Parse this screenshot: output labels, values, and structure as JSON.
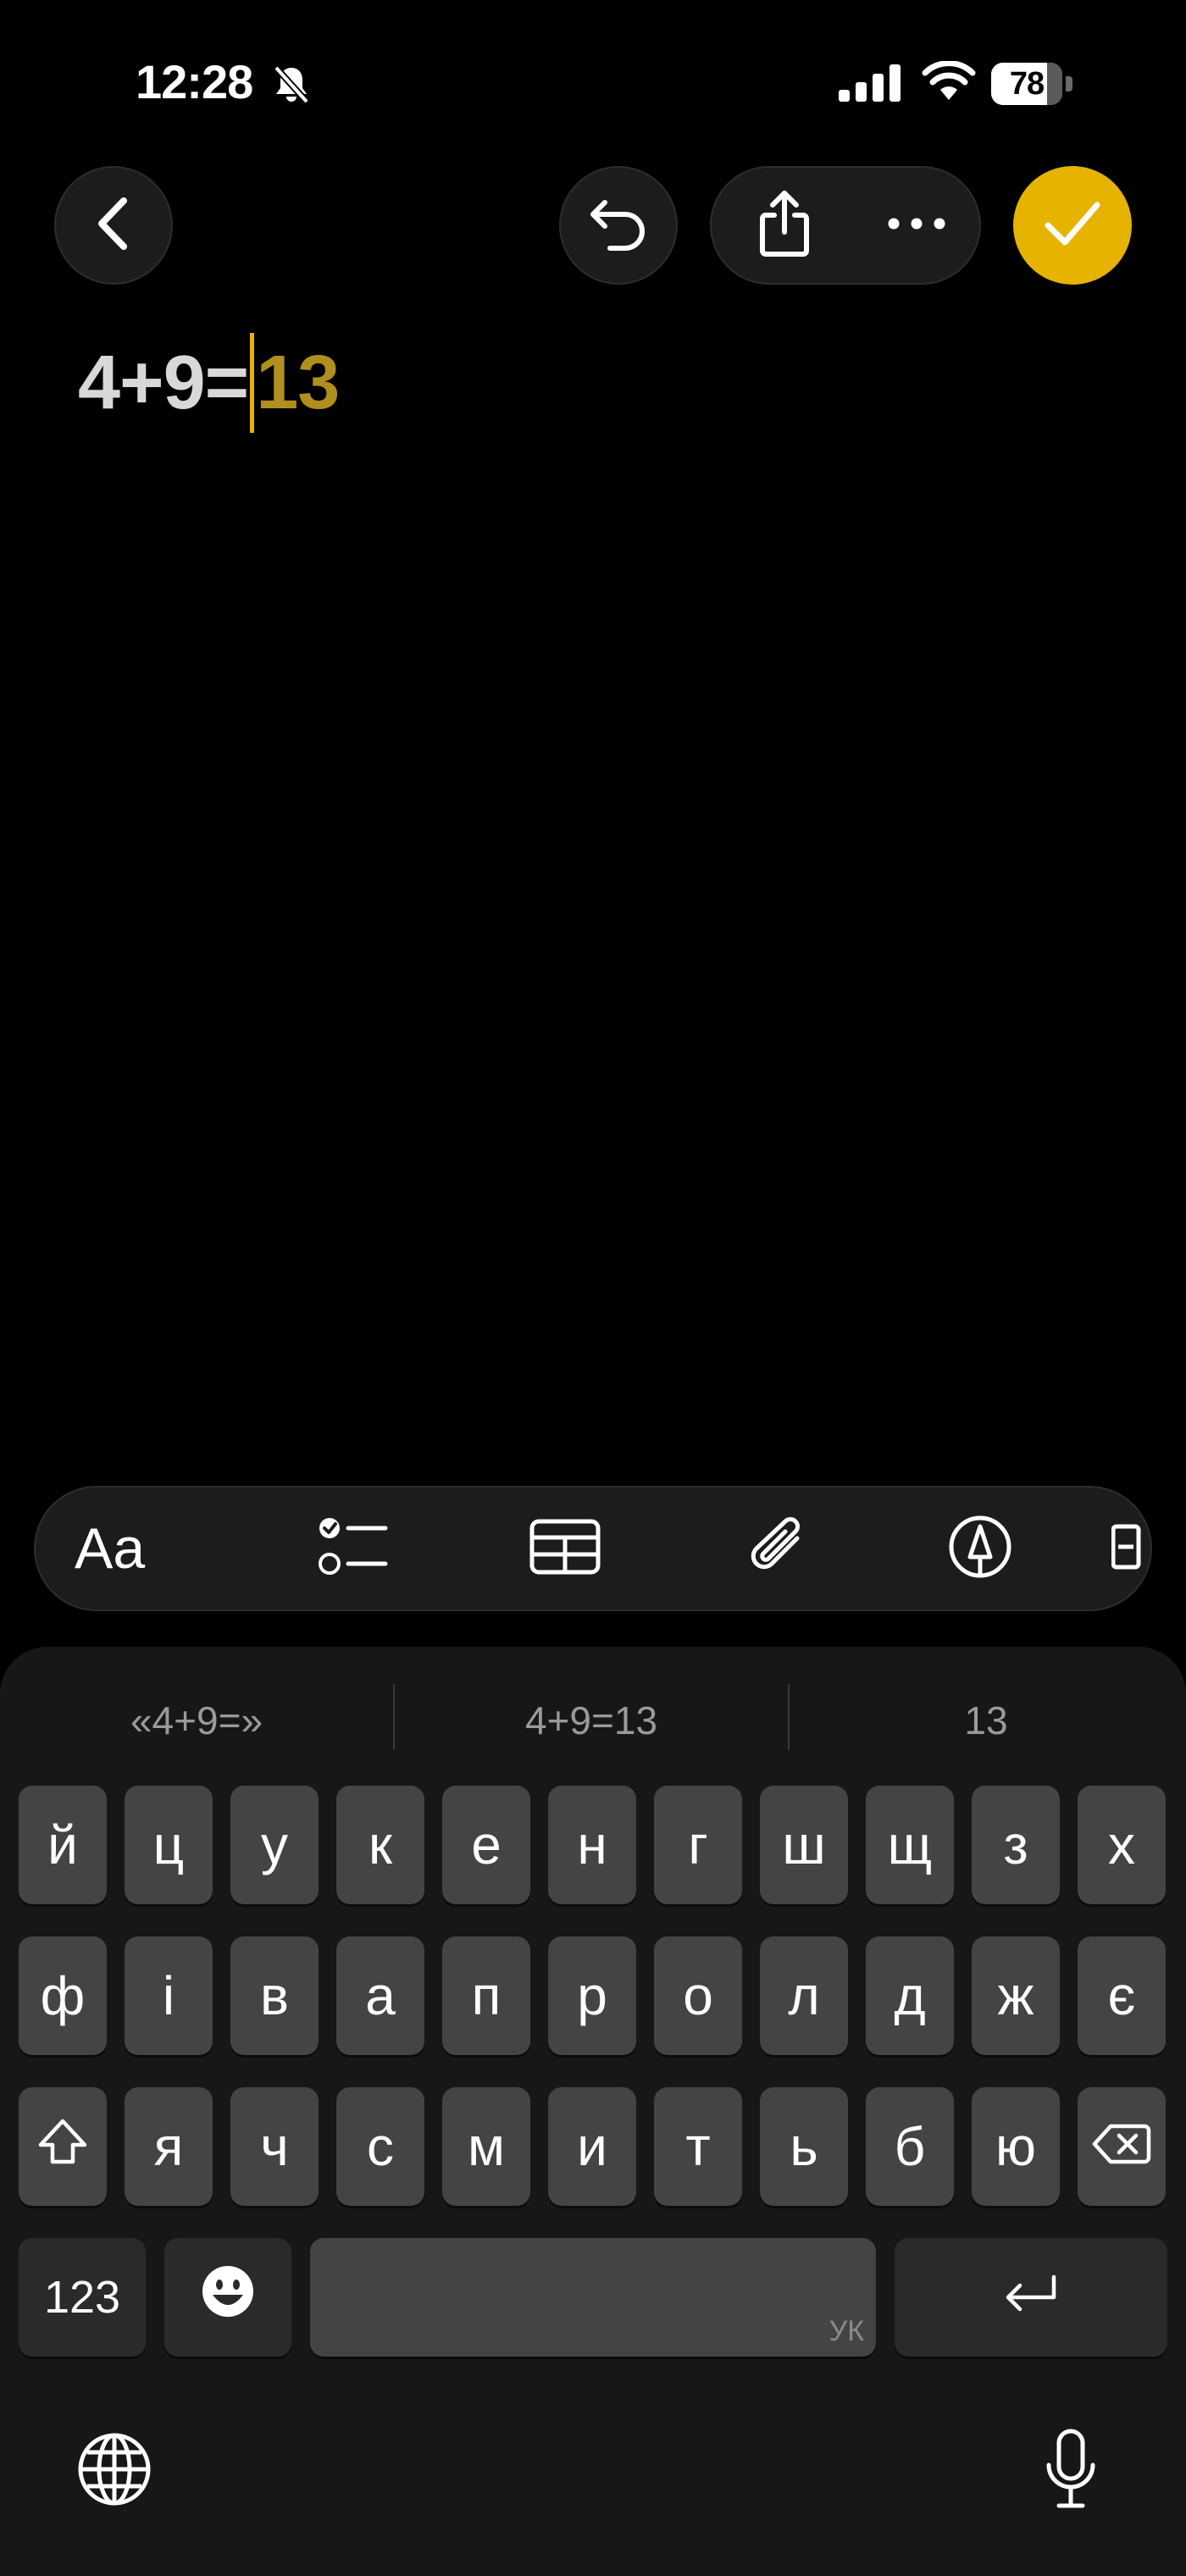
{
  "status": {
    "time": "12:28",
    "battery_level": "78",
    "battery_percent": 78,
    "icons": [
      "bell-slash-icon",
      "cellular-signal-icon",
      "wifi-icon",
      "battery-icon"
    ]
  },
  "toolbar": {
    "icons": [
      "chevron-left-icon",
      "undo-icon",
      "share-icon",
      "ellipsis-icon",
      "checkmark-icon"
    ],
    "accent_color": "#e5b300"
  },
  "note": {
    "expression": "4+9=",
    "result": "13"
  },
  "format_bar": {
    "text_style_label": "Aa",
    "icons": [
      "checklist-icon",
      "table-icon",
      "paperclip-icon",
      "markup-pen-icon"
    ]
  },
  "keyboard": {
    "suggestions": [
      "«4+9=»",
      "4+9=13",
      "13"
    ],
    "rows": [
      [
        "й",
        "ц",
        "у",
        "к",
        "е",
        "н",
        "г",
        "ш",
        "щ",
        "з",
        "х"
      ],
      [
        "ф",
        "і",
        "в",
        "а",
        "п",
        "р",
        "о",
        "л",
        "д",
        "ж",
        "є"
      ],
      [
        "я",
        "ч",
        "с",
        "м",
        "и",
        "т",
        "ь",
        "б",
        "ю"
      ]
    ],
    "numbers_label": "123",
    "language_code": "УК",
    "icons": [
      "shift-icon",
      "delete-icon",
      "emoji-icon",
      "return-icon",
      "globe-icon",
      "microphone-icon"
    ]
  }
}
